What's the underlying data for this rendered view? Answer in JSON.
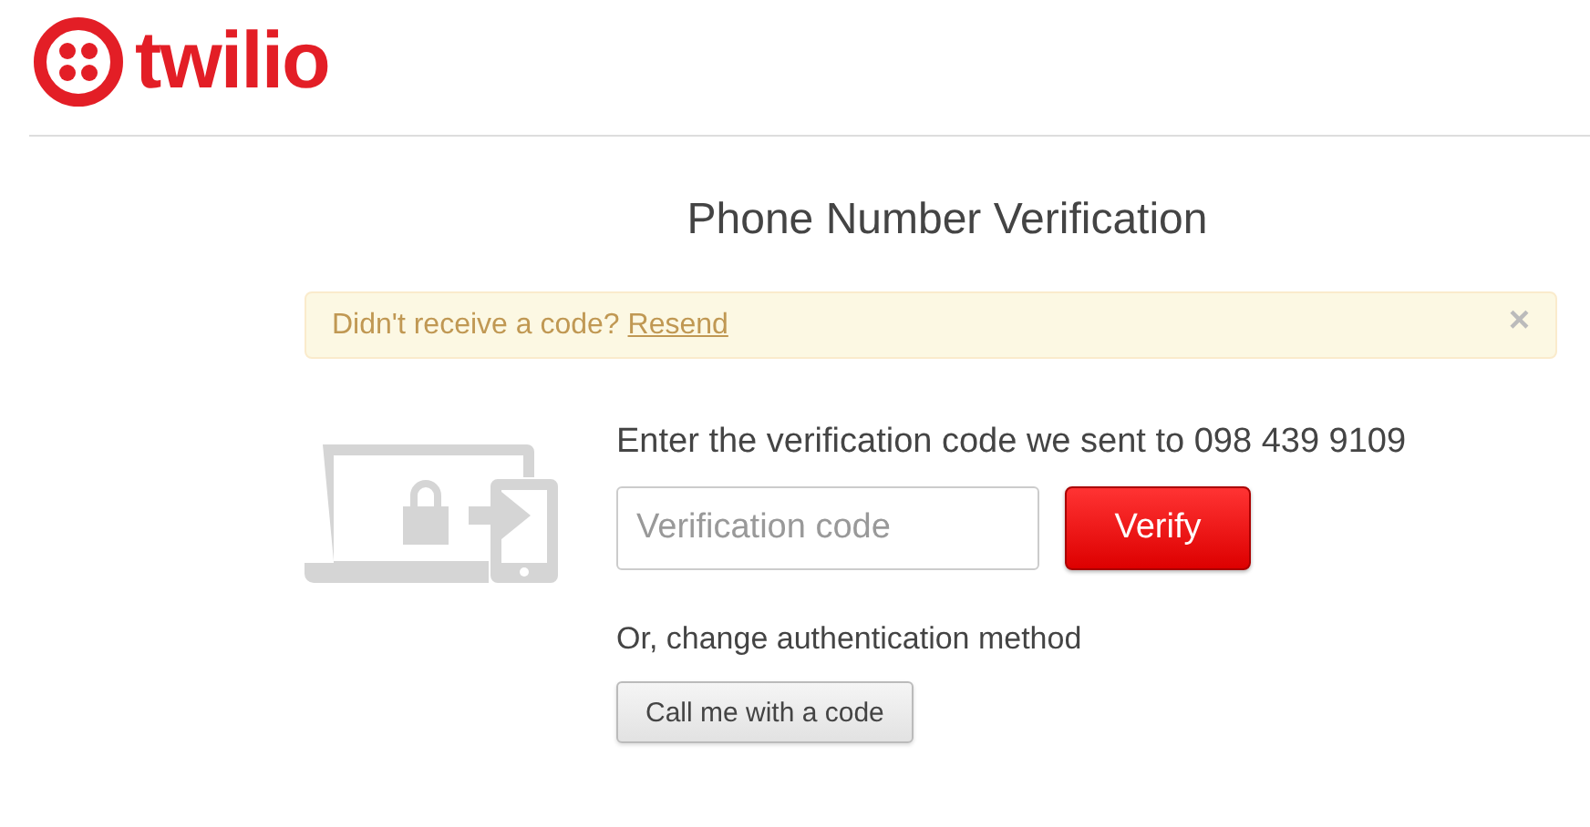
{
  "header": {
    "logo_text": "twilio"
  },
  "title": "Phone Number Verification",
  "alert": {
    "message": "Didn't receive a code?",
    "link": "Resend",
    "close": "×"
  },
  "prompt": "Enter the verification code we sent to 098 439 9109",
  "code_field": {
    "placeholder": "Verification code"
  },
  "verify_button": "Verify",
  "alternative_label": "Or, change authentication method",
  "call_button": "Call me with a code"
}
